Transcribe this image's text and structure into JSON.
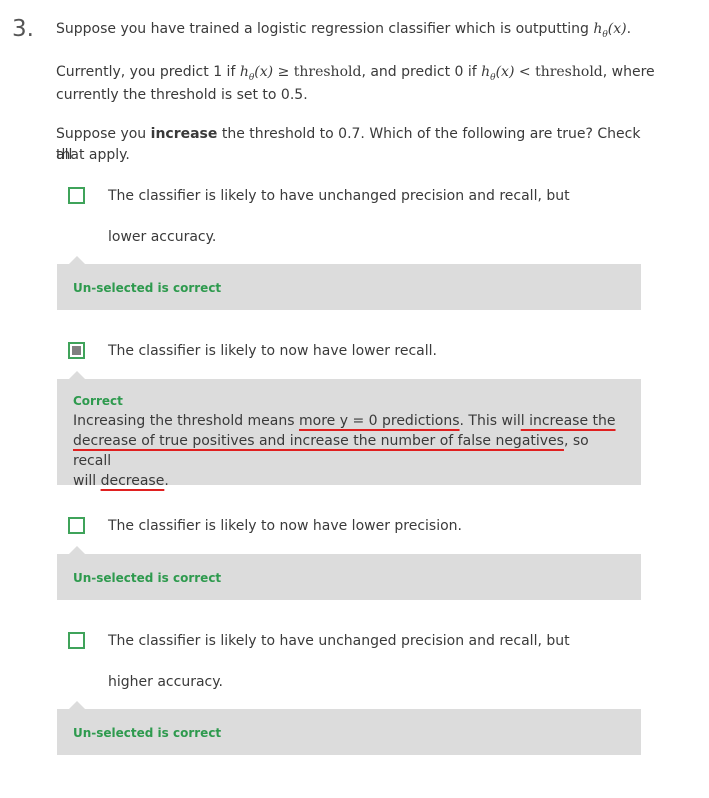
{
  "question": {
    "number": "3.",
    "line1_prefix": "Suppose you have trained a logistic regression classifier which is outputting",
    "h_theta": "hθ(x)",
    "line1_suffix": ".",
    "line2_a": "Currently, you predict 1 if",
    "line2_geq": "≥",
    "threshold": "threshold",
    "line2_b": ", and predict 0 if",
    "line2_lt": "<",
    "line2_c": ", where",
    "line3": "currently the threshold is set to 0.5.",
    "line4_a": "Suppose you",
    "line4_bold": "increase",
    "line4_b": "the threshold to 0.7. Which of the following are true? Check all",
    "line5": "that apply."
  },
  "options": [
    {
      "line1": "The classifier is likely to have unchanged precision and recall, but",
      "line2": "lower accuracy.",
      "checked": false,
      "feedback_status": "Un-selected is correct"
    },
    {
      "line1": "The classifier is likely to now have lower recall.",
      "checked": true,
      "feedback_status": "Correct",
      "feedback_l1_a": "Increasing the threshold means ",
      "feedback_l1_u1": "more y = 0 predictions",
      "feedback_l1_b": ". This wil",
      "feedback_l1_u2": "l increase the",
      "feedback_l2_u": "decrease of true positives and increase the number of false negatives",
      "feedback_l2_b": ", so recall",
      "feedback_l3_a": "will ",
      "feedback_l3_u": "decrease",
      "feedback_l3_b": "."
    },
    {
      "line1": "The classifier is likely to now have lower precision.",
      "checked": false,
      "feedback_status": "Un-selected is correct"
    },
    {
      "line1": "The classifier is likely to have unchanged precision and recall, but",
      "line2": "higher accuracy.",
      "checked": false,
      "feedback_status": "Un-selected is correct"
    }
  ],
  "colors": {
    "correct_green": "#2e9a4e",
    "checkbox_border": "#3fa35a",
    "feedback_bg": "#dcdcdc",
    "annotation_red": "#e02020"
  }
}
